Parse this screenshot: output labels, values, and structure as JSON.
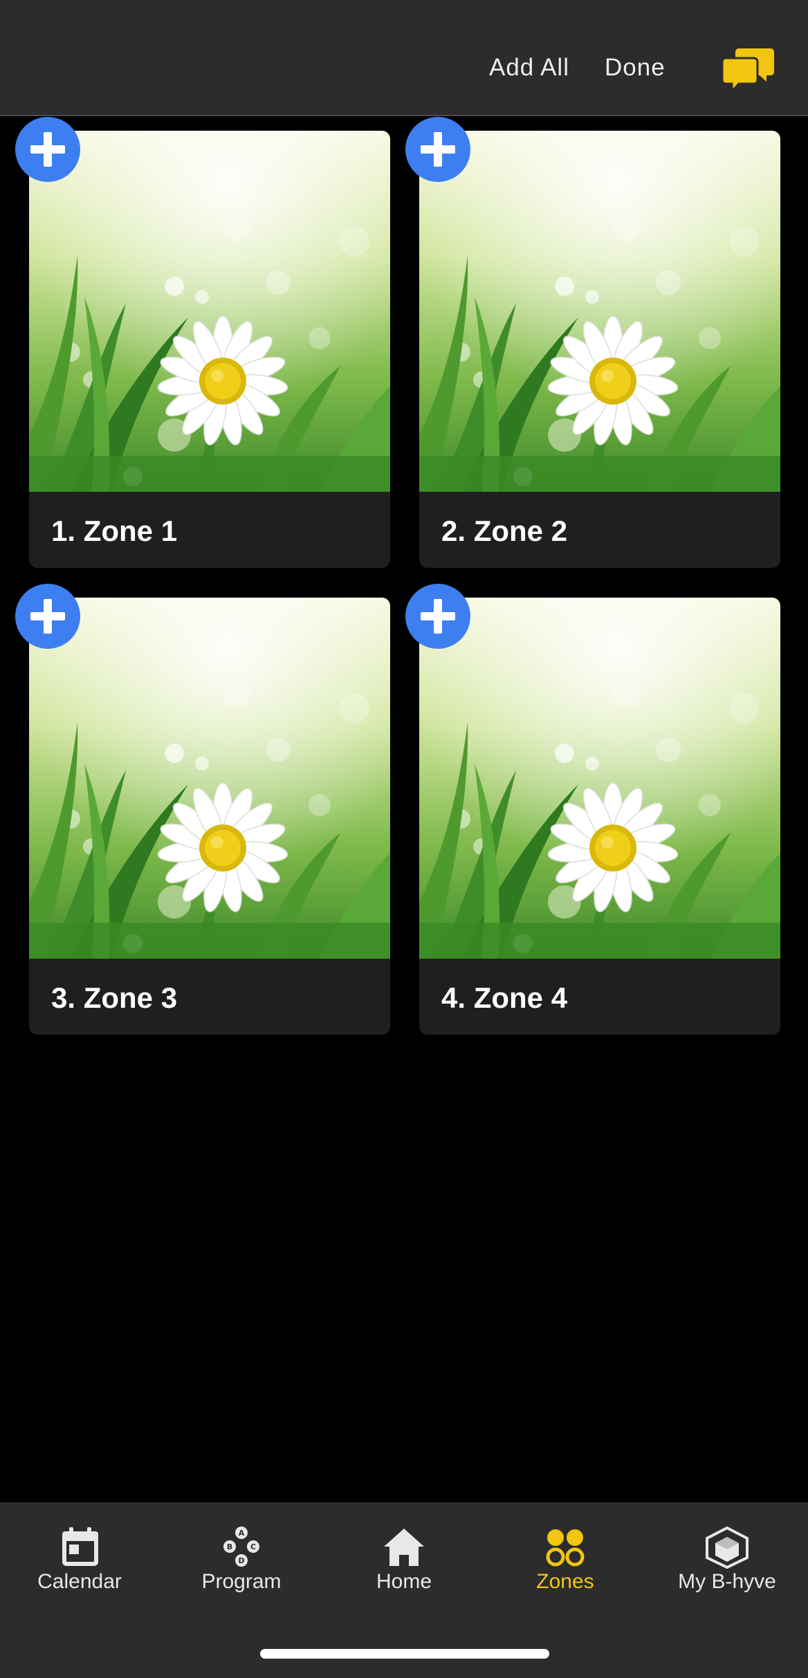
{
  "header": {
    "add_all_label": "Add All",
    "done_label": "Done",
    "chat_icon": "chat-bubbles-icon"
  },
  "zones": [
    {
      "label": "1. Zone 1"
    },
    {
      "label": "2. Zone 2"
    },
    {
      "label": "3. Zone 3"
    },
    {
      "label": "4. Zone 4"
    }
  ],
  "nav": {
    "items": [
      {
        "label": "Calendar",
        "icon": "calendar-icon"
      },
      {
        "label": "Program",
        "icon": "program-icon"
      },
      {
        "label": "Home",
        "icon": "home-icon"
      },
      {
        "label": "Zones",
        "icon": "zones-icon",
        "active": true
      },
      {
        "label": "My B-hyve",
        "icon": "hexagon-icon"
      }
    ]
  },
  "colors": {
    "accent": "#f2c511",
    "add_button": "#3d7ff0",
    "header_bg": "#2c2c2c",
    "card_bg": "#1f1f1f"
  }
}
